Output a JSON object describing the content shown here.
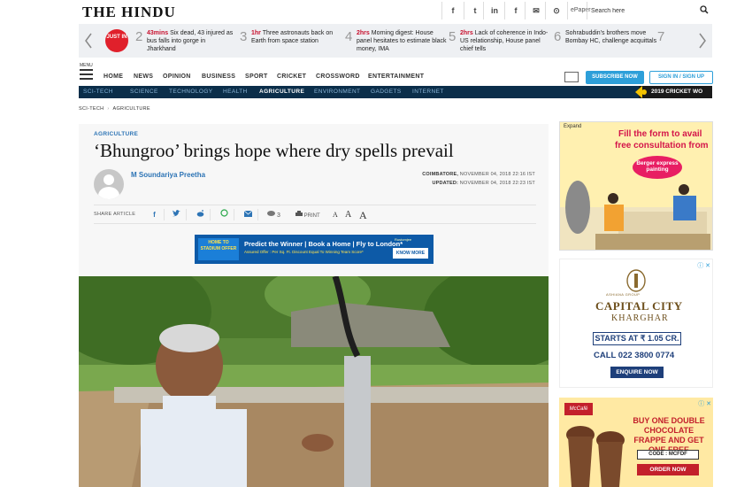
{
  "header": {
    "logo_text": "THE HINDU",
    "social": [
      "f",
      "t",
      "in",
      "f",
      "✉",
      "⊙"
    ],
    "epaper_label": "ePaper",
    "search_placeholder": "Search here"
  },
  "ticker": {
    "just_in": "JUST IN",
    "items": [
      {
        "num": "2",
        "time": "43mins",
        "text": "Six dead, 43 injured as bus falls into gorge in Jharkhand"
      },
      {
        "num": "3",
        "time": "1hr",
        "text": "Three astronauts back on Earth from space station"
      },
      {
        "num": "4",
        "time": "2hrs",
        "text": "Morning digest: House panel hesitates to estimate black money, IMA"
      },
      {
        "num": "5",
        "time": "2hrs",
        "text": "Lack of coherence in Indo-US relationship, House panel chief tells"
      },
      {
        "num": "6",
        "time": "",
        "text": "Sohrabuddin's brothers move Bombay HC, challenge acquittals"
      },
      {
        "num": "7",
        "time": "",
        "text": ""
      }
    ]
  },
  "nav": {
    "menu_label": "MENU",
    "items": [
      "HOME",
      "NEWS",
      "OPINION",
      "BUSINESS",
      "SPORT",
      "CRICKET",
      "CROSSWORD",
      "ENTERTAINMENT"
    ],
    "subscribe": "SUBSCRIBE NOW",
    "signin": "SIGN IN / SIGN UP"
  },
  "subnav": {
    "items": [
      "SCI-TECH",
      "SCIENCE",
      "TECHNOLOGY",
      "HEALTH",
      "AGRICULTURE",
      "ENVIRONMENT",
      "GADGETS",
      "INTERNET"
    ],
    "active_index": 4,
    "cricket_tag": "2019 CRICKET WO"
  },
  "breadcrumb": [
    "SCI-TECH",
    "AGRICULTURE"
  ],
  "article": {
    "section": "AGRICULTURE",
    "headline": "‘Bhungroo’ brings hope where dry spells prevail",
    "author": "M Soundariya Preetha",
    "dateline_place": "COIMBATORE,",
    "dateline_date": "NOVEMBER 04, 2018 22:16 IST",
    "updated_label": "UPDATED:",
    "updated_date": "NOVEMBER 04, 2018 22:23 IST",
    "share_label": "SHARE ARTICLE",
    "comments_count": "3",
    "print_label": "PRINT",
    "font_sizes": [
      "A",
      "A",
      "A"
    ]
  },
  "inline_ad": {
    "left_text": "HOME TO STADIUM OFFER",
    "headline": "Predict the Winner | Book a Home | Fly to London*",
    "sub": "Assured Offer : Per Sq. Ft. Discount Equal To Winning Team Score*",
    "brand": "Rustomjee",
    "cta": "KNOW MORE"
  },
  "ad1": {
    "expand": "Expand",
    "line1": "Fill the form to avail",
    "line2": "free consultation from",
    "logo": "Berger express painting"
  },
  "ad2": {
    "small": "ASHIANA GROUP",
    "title1": "CAPITAL CITY",
    "title2": "KHARGHAR",
    "price": "STARTS AT ₹ 1.05 CR.",
    "call": "CALL 022 3800 0774",
    "cta": "ENQUIRE NOW"
  },
  "ad3": {
    "logo": "McCafé",
    "text": "BUY ONE DOUBLE CHOCOLATE FRAPPE AND GET ONE FREE",
    "code": "CODE : MCFDF",
    "cta": "ORDER NOW"
  }
}
